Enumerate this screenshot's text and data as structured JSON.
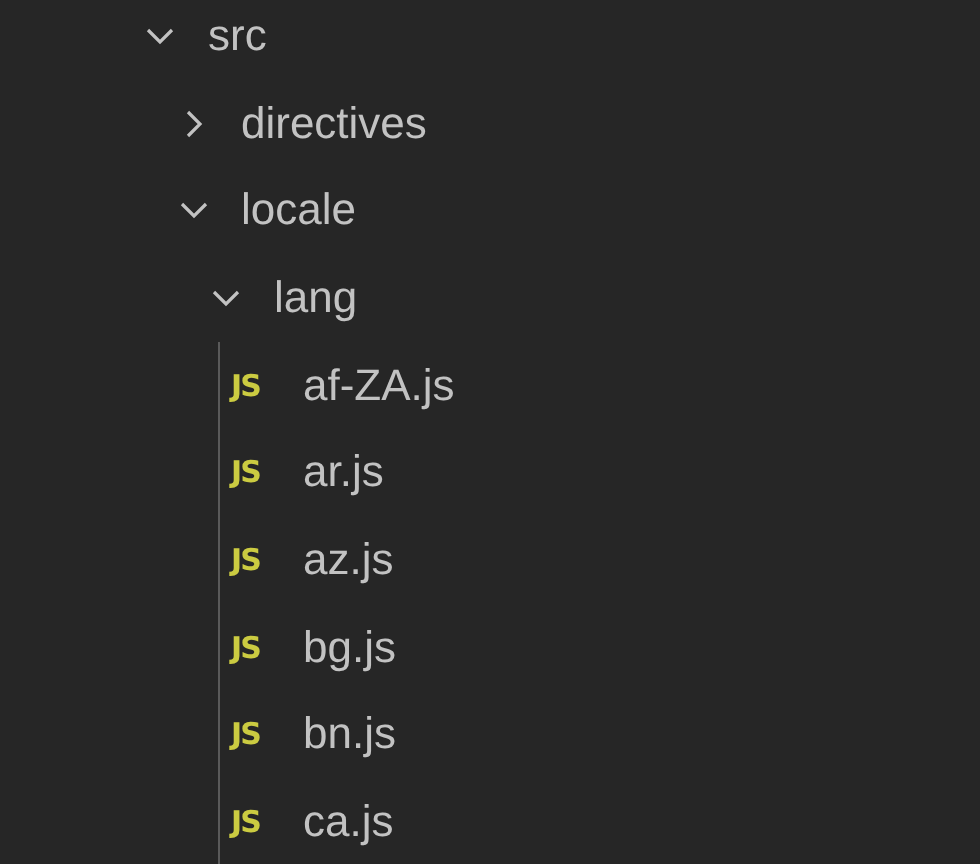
{
  "explorer": {
    "tree": [
      {
        "kind": "folder",
        "label": "src",
        "expanded": true,
        "children": [
          {
            "kind": "folder",
            "label": "directives",
            "expanded": false
          },
          {
            "kind": "folder",
            "label": "locale",
            "expanded": true,
            "children": [
              {
                "kind": "folder",
                "label": "lang",
                "expanded": true,
                "indent_guide": true,
                "children": [
                  {
                    "kind": "js",
                    "badge": "JS",
                    "label": "af-ZA.js"
                  },
                  {
                    "kind": "js",
                    "badge": "JS",
                    "label": "ar.js"
                  },
                  {
                    "kind": "js",
                    "badge": "JS",
                    "label": "az.js"
                  },
                  {
                    "kind": "js",
                    "badge": "JS",
                    "label": "bg.js"
                  },
                  {
                    "kind": "js",
                    "badge": "JS",
                    "label": "bn.js"
                  },
                  {
                    "kind": "js",
                    "badge": "JS",
                    "label": "ca.js"
                  }
                ]
              }
            ]
          }
        ]
      }
    ]
  }
}
